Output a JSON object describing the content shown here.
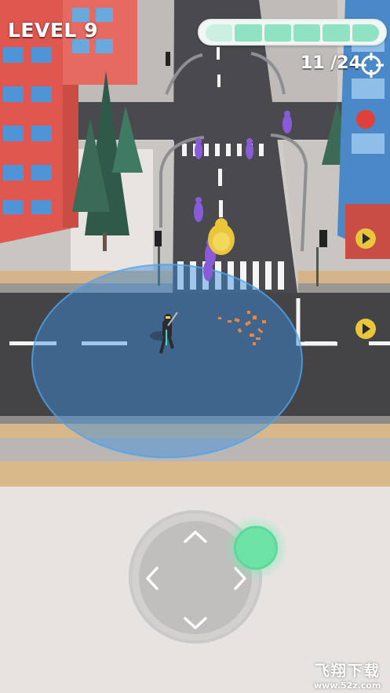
{
  "hud": {
    "level_label": "LEVEL 9",
    "progress_segments": 6,
    "progress_filled": 6,
    "counter_text": "11 /24"
  },
  "watermark": {
    "title": "飞翔下载",
    "url": "www.52z.com"
  },
  "colors": {
    "asphalt": "#46464a",
    "sidewalk": "#c7c4c1",
    "curb_tan": "#d4b488",
    "building_red": "#e0574f",
    "building_window": "#4f94d6",
    "radius_blue": "#3a8fe0",
    "enemy_purple": "#8a5bd8",
    "boss_yellow": "#e9c63b",
    "knob_green": "#6ee3a8"
  }
}
